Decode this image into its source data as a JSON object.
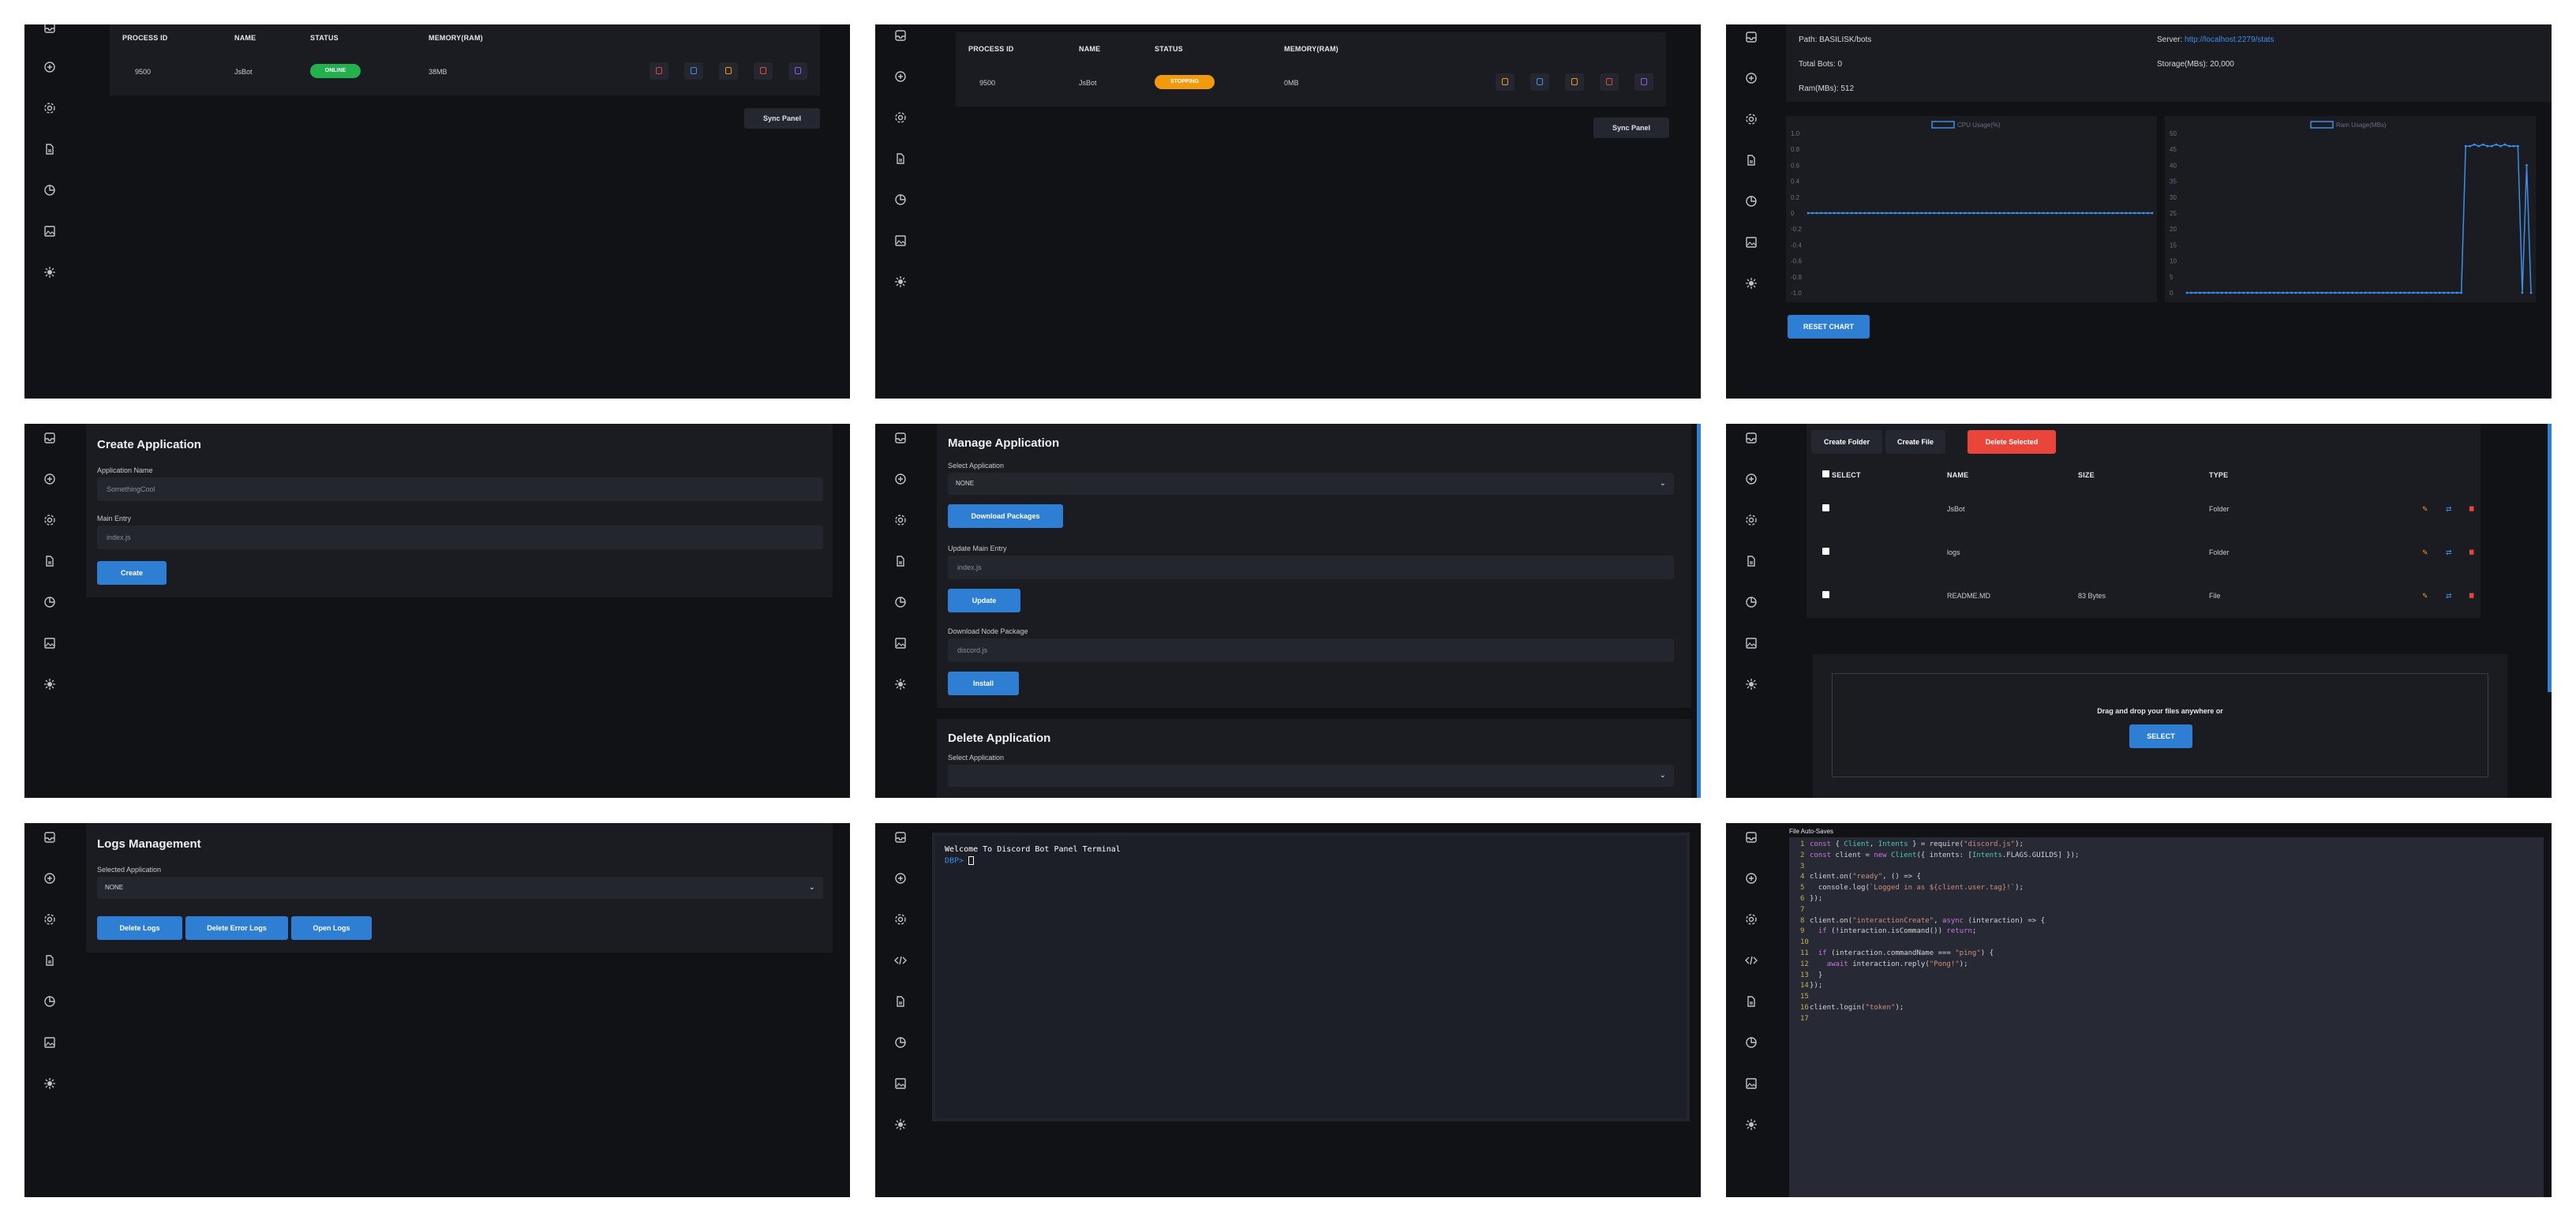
{
  "sidebar_icons": [
    "inbox-icon",
    "plus-circle-icon",
    "gear-icon",
    "file-icon",
    "pie-chart-icon",
    "image-icon",
    "sun-icon"
  ],
  "sidebar_icons_code": [
    "inbox-icon",
    "plus-circle-icon",
    "gear-icon",
    "code-icon",
    "file-icon",
    "pie-chart-icon",
    "image-icon",
    "sun-icon"
  ],
  "process": {
    "headers": [
      "PROCESS ID",
      "NAME",
      "STATUS",
      "MEMORY(RAM)"
    ],
    "pid": "9500",
    "name": "JsBot",
    "status_online": "ONLINE",
    "status_stopping": "STOPPING",
    "memory_1": "38MB",
    "memory_2": "0MB",
    "sync_label": "Sync Panel",
    "colors": {
      "online": "#22b14c",
      "stopping": "#f29a0e"
    }
  },
  "stats": {
    "path_label": "Path: BASILISK/bots",
    "server_label": "Server: ",
    "server_link": "http://localhost:2279/stats",
    "bots_label": "Total Bots: 0",
    "storage_label": "Storage(MBs): 20,000",
    "ram_label": "Ram(MBs): 512",
    "reset_label": "RESET CHART"
  },
  "chart_data": [
    {
      "type": "line",
      "series": [
        {
          "name": "CPU Usage(%)",
          "values": [
            0,
            0,
            0,
            0,
            0,
            0,
            0,
            0,
            0,
            0,
            0,
            0,
            0,
            0,
            0,
            0,
            0,
            0,
            0,
            0,
            0,
            0,
            0,
            0,
            0,
            0,
            0,
            0,
            0,
            0,
            0,
            0,
            0,
            0,
            0,
            0,
            0,
            0,
            0,
            0,
            0,
            0,
            0,
            0,
            0,
            0,
            0,
            0,
            0,
            0,
            0,
            0,
            0,
            0,
            0,
            0,
            0,
            0,
            0,
            0,
            0,
            0,
            0,
            0,
            0,
            0,
            0,
            0,
            0,
            0,
            0,
            0,
            0,
            0,
            0,
            0,
            0,
            0,
            0,
            0
          ]
        }
      ],
      "yticks": [
        "1.0",
        "0.8",
        "0.6",
        "0.4",
        "0.2",
        "0",
        "-0.2",
        "-0.4",
        "-0.6",
        "-0.8",
        "-1.0"
      ],
      "ylim": [
        -1,
        1
      ],
      "color": "#3c8ee6"
    },
    {
      "type": "line",
      "series": [
        {
          "name": "Ram Usage(MBs)",
          "values": [
            0,
            0,
            0,
            0,
            0,
            0,
            0,
            0,
            0,
            0,
            0,
            0,
            0,
            0,
            0,
            0,
            0,
            0,
            0,
            0,
            0,
            0,
            0,
            0,
            0,
            0,
            0,
            0,
            0,
            0,
            0,
            0,
            0,
            0,
            0,
            0,
            0,
            0,
            0,
            0,
            0,
            0,
            0,
            0,
            0,
            0,
            0,
            0,
            0,
            0,
            0,
            0,
            0,
            0,
            0,
            0,
            0,
            0,
            0,
            0,
            0,
            0,
            0,
            0,
            46,
            46,
            46.5,
            46,
            46.5,
            46,
            46,
            46.5,
            46,
            46.5,
            46,
            46,
            46,
            0,
            40,
            0
          ]
        }
      ],
      "yticks": [
        "50",
        "45",
        "40",
        "35",
        "30",
        "25",
        "20",
        "15",
        "10",
        "5",
        "0"
      ],
      "ylim": [
        0,
        50
      ],
      "color": "#3c8ee6"
    }
  ],
  "create_app": {
    "title": "Create Application",
    "name_label": "Application Name",
    "name_placeholder": "SomethingCool",
    "entry_label": "Main Entry",
    "entry_placeholder": "index.js",
    "create_label": "Create"
  },
  "manage_app": {
    "title": "Manage Application",
    "select_label": "Select Application",
    "select_value": "NONE",
    "download_label": "Download Packages",
    "update_entry_label": "Update Main Entry",
    "update_placeholder": "index.js",
    "update_button": "Update",
    "node_pkg_label": "Download Node Package",
    "node_pkg_placeholder": "discord.js",
    "install_label": "Install",
    "delete_title": "Delete Application",
    "delete_select_label": "Select Application"
  },
  "files": {
    "create_folder": "Create Folder",
    "create_file": "Create File",
    "delete_selected": "Delete Selected",
    "headers": [
      "SELECT",
      "NAME",
      "SIZE",
      "TYPE"
    ],
    "rows": [
      {
        "name": "JsBot",
        "size": "",
        "type": "Folder"
      },
      {
        "name": "logs",
        "size": "",
        "type": "Folder"
      },
      {
        "name": "README.MD",
        "size": "83 Bytes",
        "type": "File"
      }
    ],
    "drop_text": "Drag and drop your files anywhere or",
    "select_label": "SELECT",
    "delete_color": "#e9453a"
  },
  "logs": {
    "title": "Logs Management",
    "selected_label": "Selected Application",
    "selected_value": "NONE",
    "delete_logs": "Delete Logs",
    "delete_error_logs": "Delete Error Logs",
    "open_logs": "Open Logs"
  },
  "terminal": {
    "welcome": "Welcome To Discord Bot Panel Terminal",
    "prompt": "DBP>"
  },
  "editor": {
    "autosave": "File Auto-Saves",
    "lines": [
      "const { Client, Intents } = require(\"discord.js\");",
      "const client = new Client({ intents: [Intents.FLAGS.GUILDS] });",
      "",
      "client.on(\"ready\", () => {",
      "  console.log(`Logged in as ${client.user.tag}!`);",
      "});",
      "",
      "client.on(\"interactionCreate\", async (interaction) => {",
      "  if (!interaction.isCommand()) return;",
      "",
      "  if (interaction.commandName === \"ping\") {",
      "    await interaction.reply(\"Pong!\");",
      "  }",
      "});",
      "",
      "client.login(\"token\");",
      ""
    ]
  }
}
